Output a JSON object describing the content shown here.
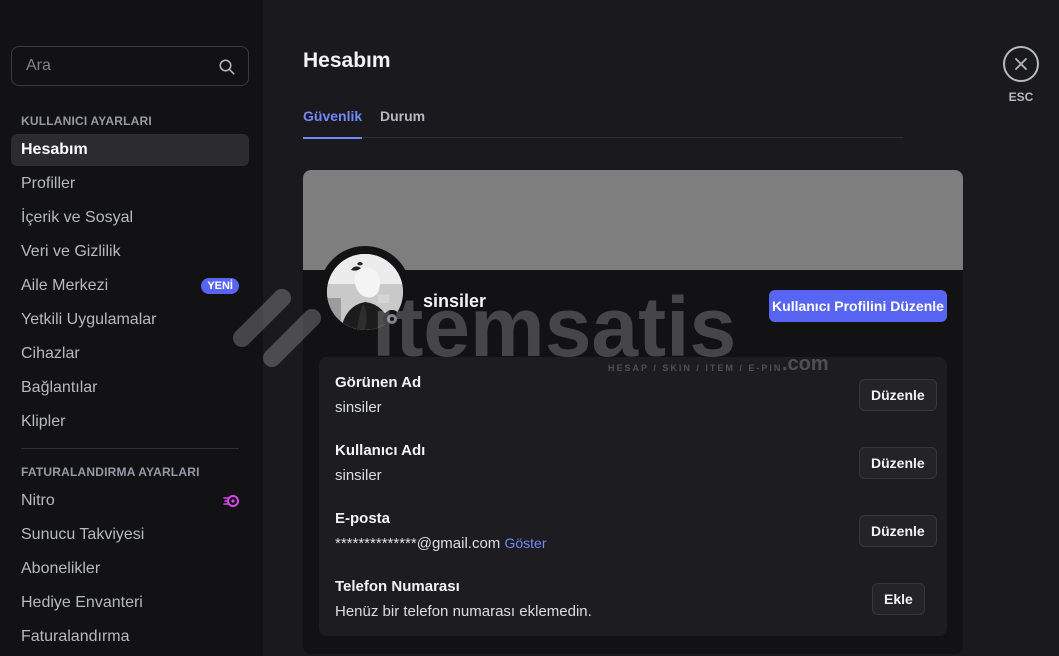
{
  "sidebar": {
    "search": {
      "placeholder": "Ara"
    },
    "sections": [
      {
        "title": "KULLANICI AYARLARI",
        "items": [
          {
            "label": "Hesabım",
            "active": true
          },
          {
            "label": "Profiller"
          },
          {
            "label": "İçerik ve Sosyal"
          },
          {
            "label": "Veri ve Gizlilik"
          },
          {
            "label": "Aile Merkezi",
            "badge": "YENİ"
          },
          {
            "label": "Yetkili Uygulamalar"
          },
          {
            "label": "Cihazlar"
          },
          {
            "label": "Bağlantılar"
          },
          {
            "label": "Klipler"
          }
        ]
      },
      {
        "title": "FATURALANDIRMA AYARLARI",
        "items": [
          {
            "label": "Nitro",
            "icon": "nitro-icon"
          },
          {
            "label": "Sunucu Takviyesi"
          },
          {
            "label": "Abonelikler"
          },
          {
            "label": "Hediye Envanteri"
          },
          {
            "label": "Faturalandırma"
          }
        ]
      }
    ]
  },
  "main": {
    "title": "Hesabım",
    "tabs": [
      {
        "label": "Güvenlik",
        "active": true
      },
      {
        "label": "Durum"
      }
    ],
    "close": {
      "label": "ESC"
    }
  },
  "profile": {
    "banner_color": "#7e7e7e",
    "username": "sinsiler",
    "edit_profile_label": "Kullanıcı Profilini Düzenle",
    "status": "offline"
  },
  "fields": [
    {
      "label": "Görünen Ad",
      "value": "sinsiler",
      "button": "Düzenle"
    },
    {
      "label": "Kullanıcı Adı",
      "value": "sinsiler",
      "button": "Düzenle"
    },
    {
      "label": "E-posta",
      "value": "**************@gmail.com",
      "link": "Göster",
      "button": "Düzenle"
    },
    {
      "label": "Telefon Numarası",
      "value": "Henüz bir telefon numarası eklemedin.",
      "button": "Ekle"
    }
  ],
  "watermark": {
    "brand": "itemsatis",
    "tld": ".com",
    "tagline": "HESAP / SKIN / ITEM / E-PIN"
  },
  "colors": {
    "accent": "#5865f2",
    "link": "#7289f7",
    "sidebar_bg": "#121214",
    "main_bg": "#1a1a1e"
  }
}
